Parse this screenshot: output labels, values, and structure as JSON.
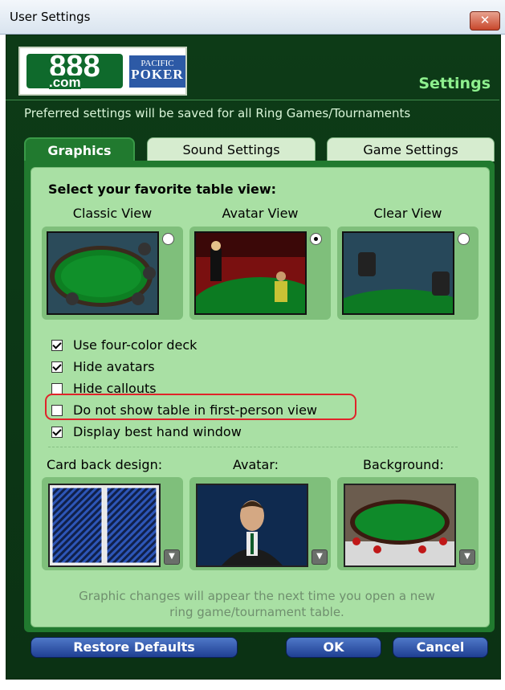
{
  "window": {
    "title": "User Settings",
    "close_symbol": "✕"
  },
  "header": {
    "logo_888": "888",
    "logo_com": ".com",
    "logo_pacific": "PACIFIC",
    "logo_poker": "POKER",
    "title": "Settings",
    "subtitle": "Preferred settings will be saved for all Ring Games/Tournaments"
  },
  "tabs": [
    {
      "label": "Graphics",
      "active": true
    },
    {
      "label": "Sound Settings",
      "active": false
    },
    {
      "label": "Game Settings",
      "active": false
    }
  ],
  "graphics": {
    "heading": "Select your favorite table view:",
    "views": [
      {
        "label": "Classic View",
        "selected": false
      },
      {
        "label": "Avatar View",
        "selected": true
      },
      {
        "label": "Clear View",
        "selected": false
      }
    ],
    "options": [
      {
        "label": "Use four-color deck",
        "checked": true
      },
      {
        "label": "Hide avatars",
        "checked": true
      },
      {
        "label": "Hide callouts",
        "checked": false
      },
      {
        "label": "Do not show table in first-person view",
        "checked": false
      },
      {
        "label": "Display best hand window",
        "checked": true
      }
    ],
    "bottom_labels": [
      "Card back design:",
      "Avatar:",
      "Background:"
    ],
    "dropdown_symbol": "▼",
    "note_line1": "Graphic changes will appear the next time you open a new",
    "note_line2": "ring game/tournament table."
  },
  "buttons": {
    "restore": "Restore Defaults",
    "ok": "OK",
    "cancel": "Cancel"
  },
  "colors": {
    "panel_green": "#217a2f",
    "inner_green": "#a9e0a4",
    "button_blue": "#2f55a8",
    "highlight_red": "#e0242a"
  }
}
